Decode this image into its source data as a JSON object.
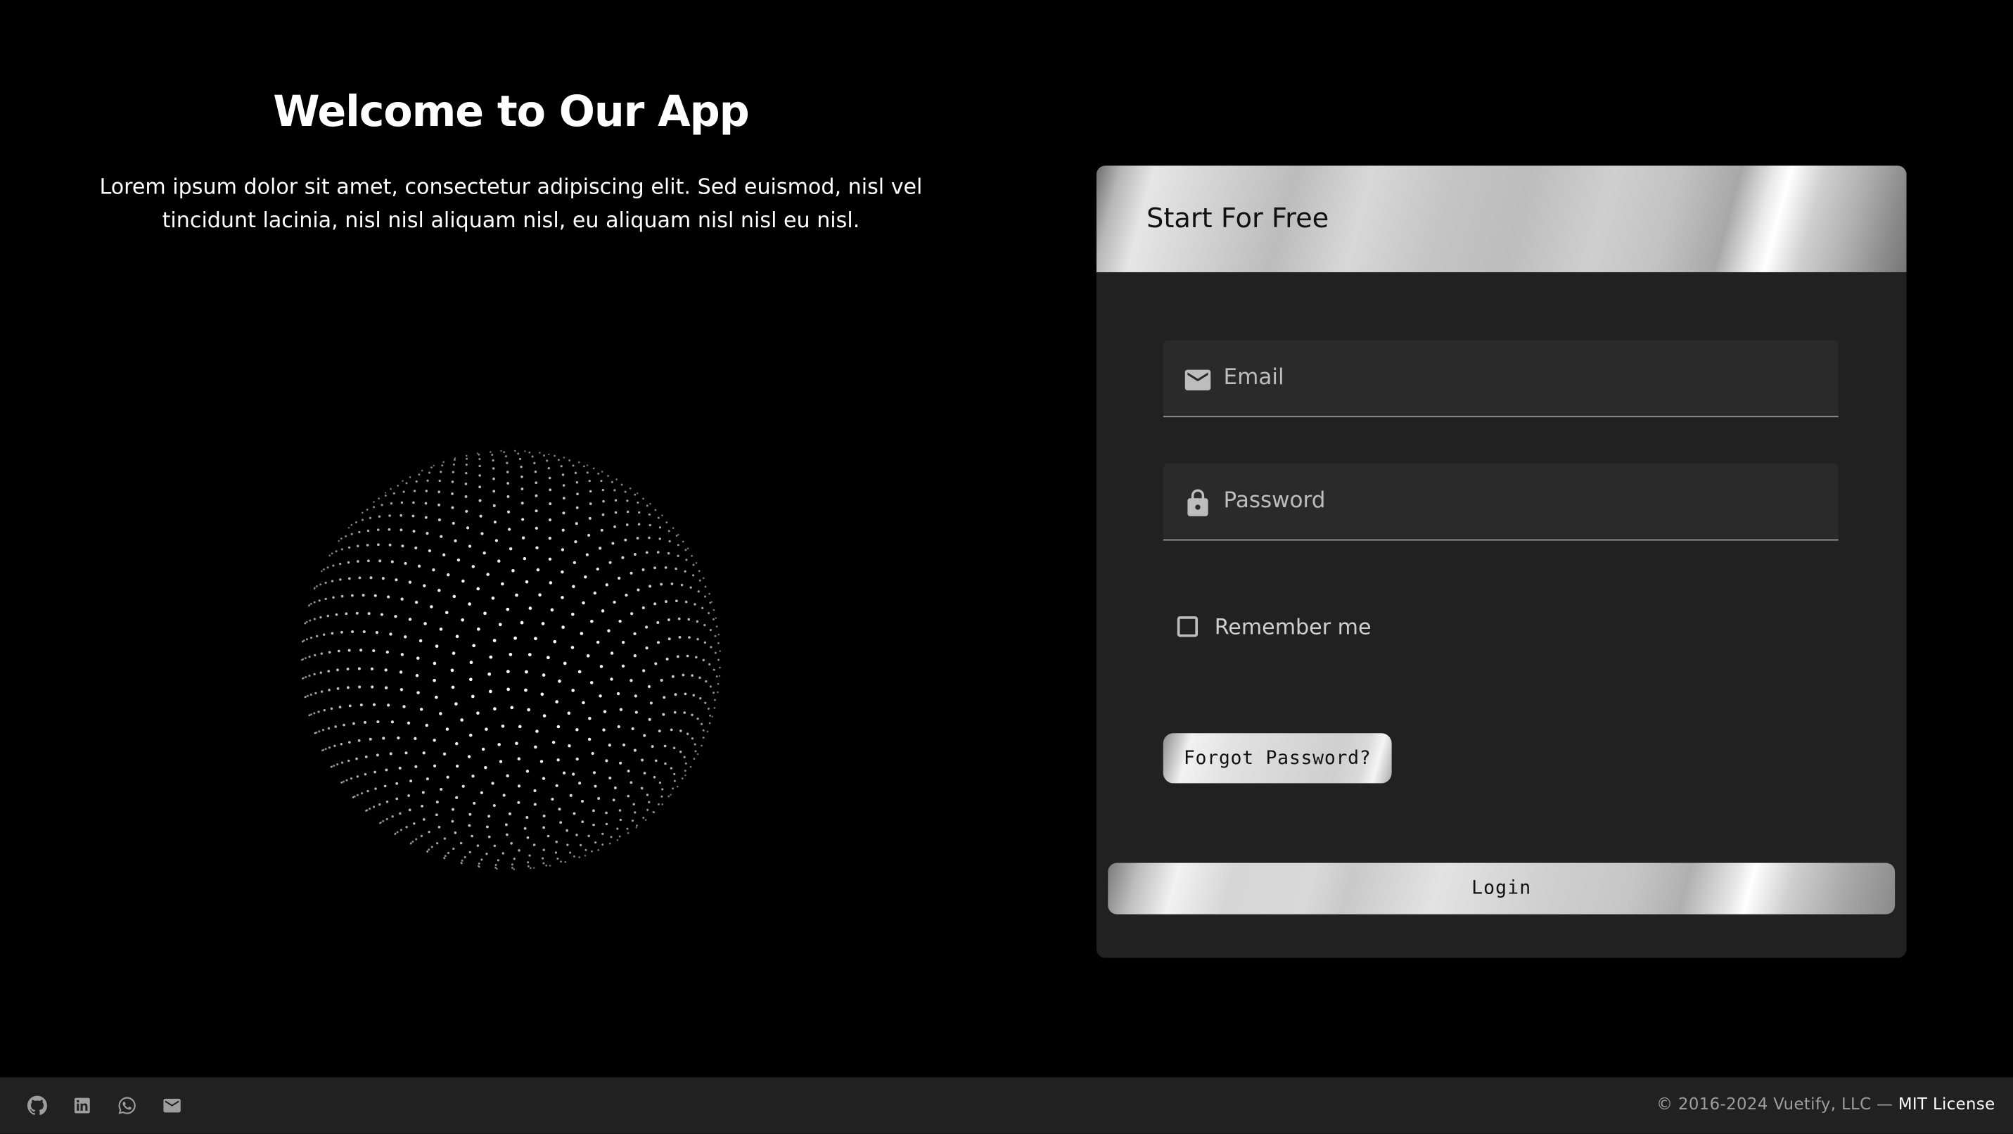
{
  "hero": {
    "title": "Welcome to Our App",
    "subtitle": "Lorem ipsum dolor sit amet, consectetur adipiscing elit. Sed euismod, nisl vel tincidunt lacinia, nisl nisl aliquam nisl, eu aliquam nisl nisl eu nisl.",
    "graphic": "particle-sphere"
  },
  "card": {
    "title": "Start For Free",
    "email": {
      "value": "",
      "placeholder": "Email",
      "icon": "email-icon"
    },
    "password": {
      "value": "",
      "placeholder": "Password",
      "icon": "lock-icon"
    },
    "remember": {
      "label": "Remember me",
      "checked": false
    },
    "forgot_label": "Forgot Password?",
    "login_label": "Login"
  },
  "footer": {
    "icons": [
      "github-icon",
      "linkedin-icon",
      "whatsapp-icon",
      "email-icon"
    ],
    "copyright": "© 2016-2024 Vuetify, LLC —",
    "license": "MIT License"
  },
  "colors": {
    "background": "#000000",
    "card": "#212121",
    "field": "#2a2a2a",
    "footer": "#212121"
  }
}
